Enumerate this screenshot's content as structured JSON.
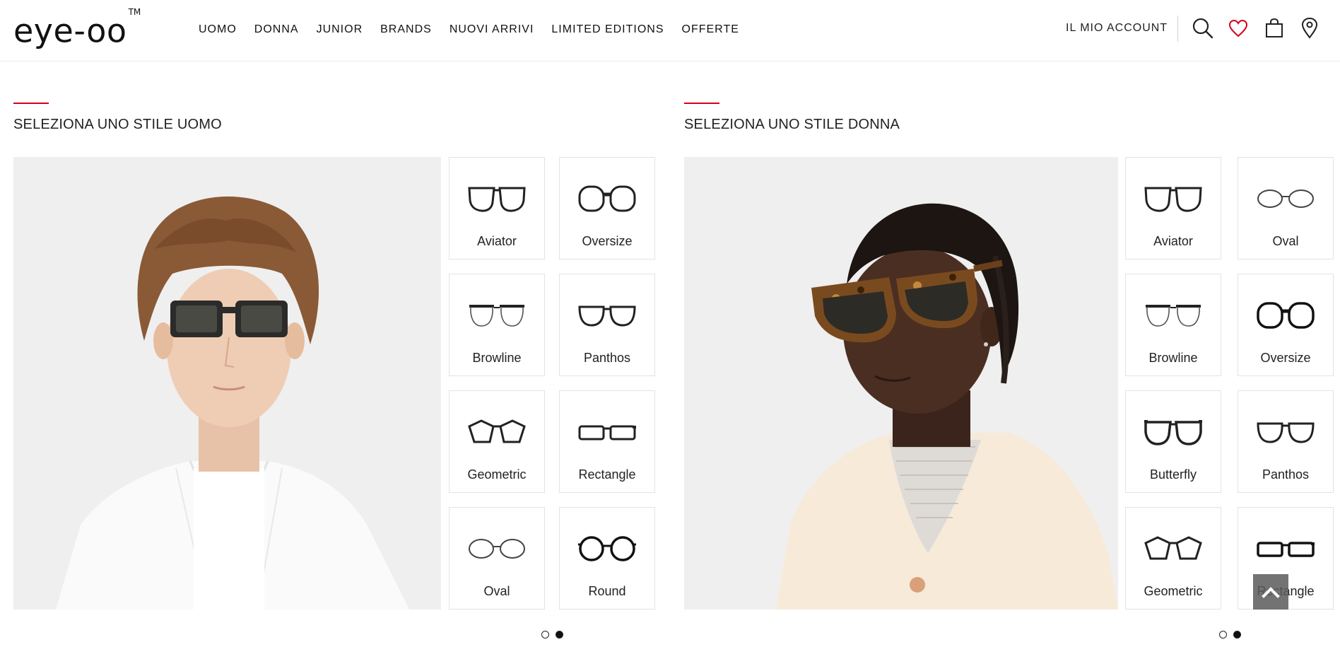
{
  "header": {
    "logo": "eye-oo",
    "logo_mark": "TM",
    "nav": [
      "UOMO",
      "DONNA",
      "JUNIOR",
      "BRANDS",
      "NUOVI ARRIVI",
      "LIMITED EDITIONS",
      "OFFERTE"
    ],
    "account_label": "IL MIO ACCOUNT",
    "icons": [
      "search-icon",
      "heart-icon",
      "shopping-bag-icon",
      "location-pin-icon"
    ],
    "accent_color": "#d0021b"
  },
  "men": {
    "title": "SELEZIONA UNO STILE UOMO",
    "image": "man-wearing-black-sunglasses",
    "styles": [
      "Aviator",
      "Oversize",
      "Browline",
      "Panthos",
      "Geometric",
      "Rectangle",
      "Oval",
      "Round"
    ],
    "carousel": {
      "pages": 2,
      "active": 2
    }
  },
  "women": {
    "title": "SELEZIONA UNO STILE DONNA",
    "image": "woman-wearing-tortoise-sunglasses",
    "styles": [
      "Aviator",
      "Oval",
      "Browline",
      "Oversize",
      "Butterfly",
      "Panthos",
      "Geometric",
      "Rectangle"
    ],
    "carousel": {
      "pages": 2,
      "active": 2
    }
  },
  "back_to_top_icon": "chevron-up-icon"
}
